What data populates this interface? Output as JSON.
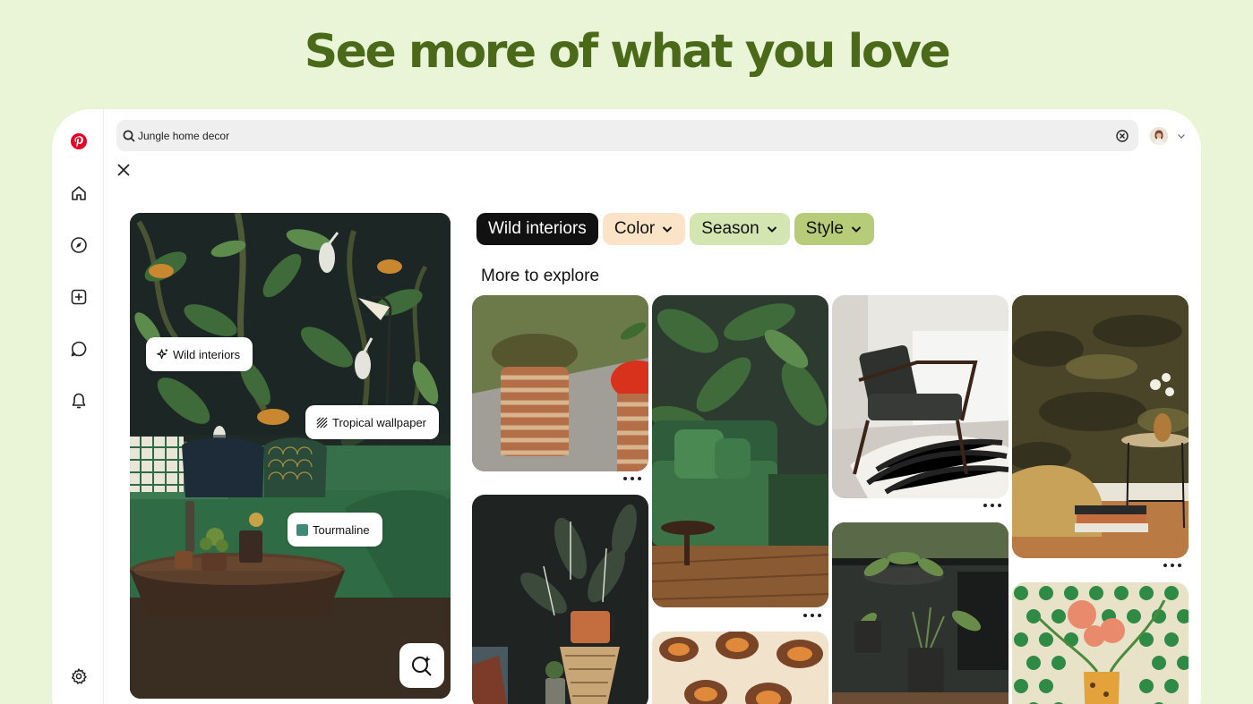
{
  "headline": "See more of what you love",
  "sidebar": {
    "items": [
      {
        "name": "pinterest-logo-icon"
      },
      {
        "name": "home-icon"
      },
      {
        "name": "explore-compass-icon"
      },
      {
        "name": "create-plus-icon"
      },
      {
        "name": "messages-icon"
      },
      {
        "name": "notifications-bell-icon"
      },
      {
        "name": "settings-gear-icon"
      }
    ]
  },
  "search": {
    "value": "Jungle home decor",
    "icon": "search-icon"
  },
  "hero": {
    "chips": {
      "wild_interiors": "Wild interiors",
      "tropical_wallpaper": "Tropical wallpaper",
      "tourmaline": "Tourmaline"
    },
    "tourmaline_color": "#3c8a78"
  },
  "filters": {
    "wild_interiors": "Wild interiors",
    "color": "Color",
    "season": "Season",
    "style": "Style"
  },
  "section_title": "More to explore",
  "colors": {
    "headline": "#4a6a1a",
    "background": "#e9f5d6",
    "pinterest_red": "#e60023",
    "pill_color": "#fbe3c8",
    "pill_season": "#d3e5b0",
    "pill_style": "#b6cc78"
  }
}
